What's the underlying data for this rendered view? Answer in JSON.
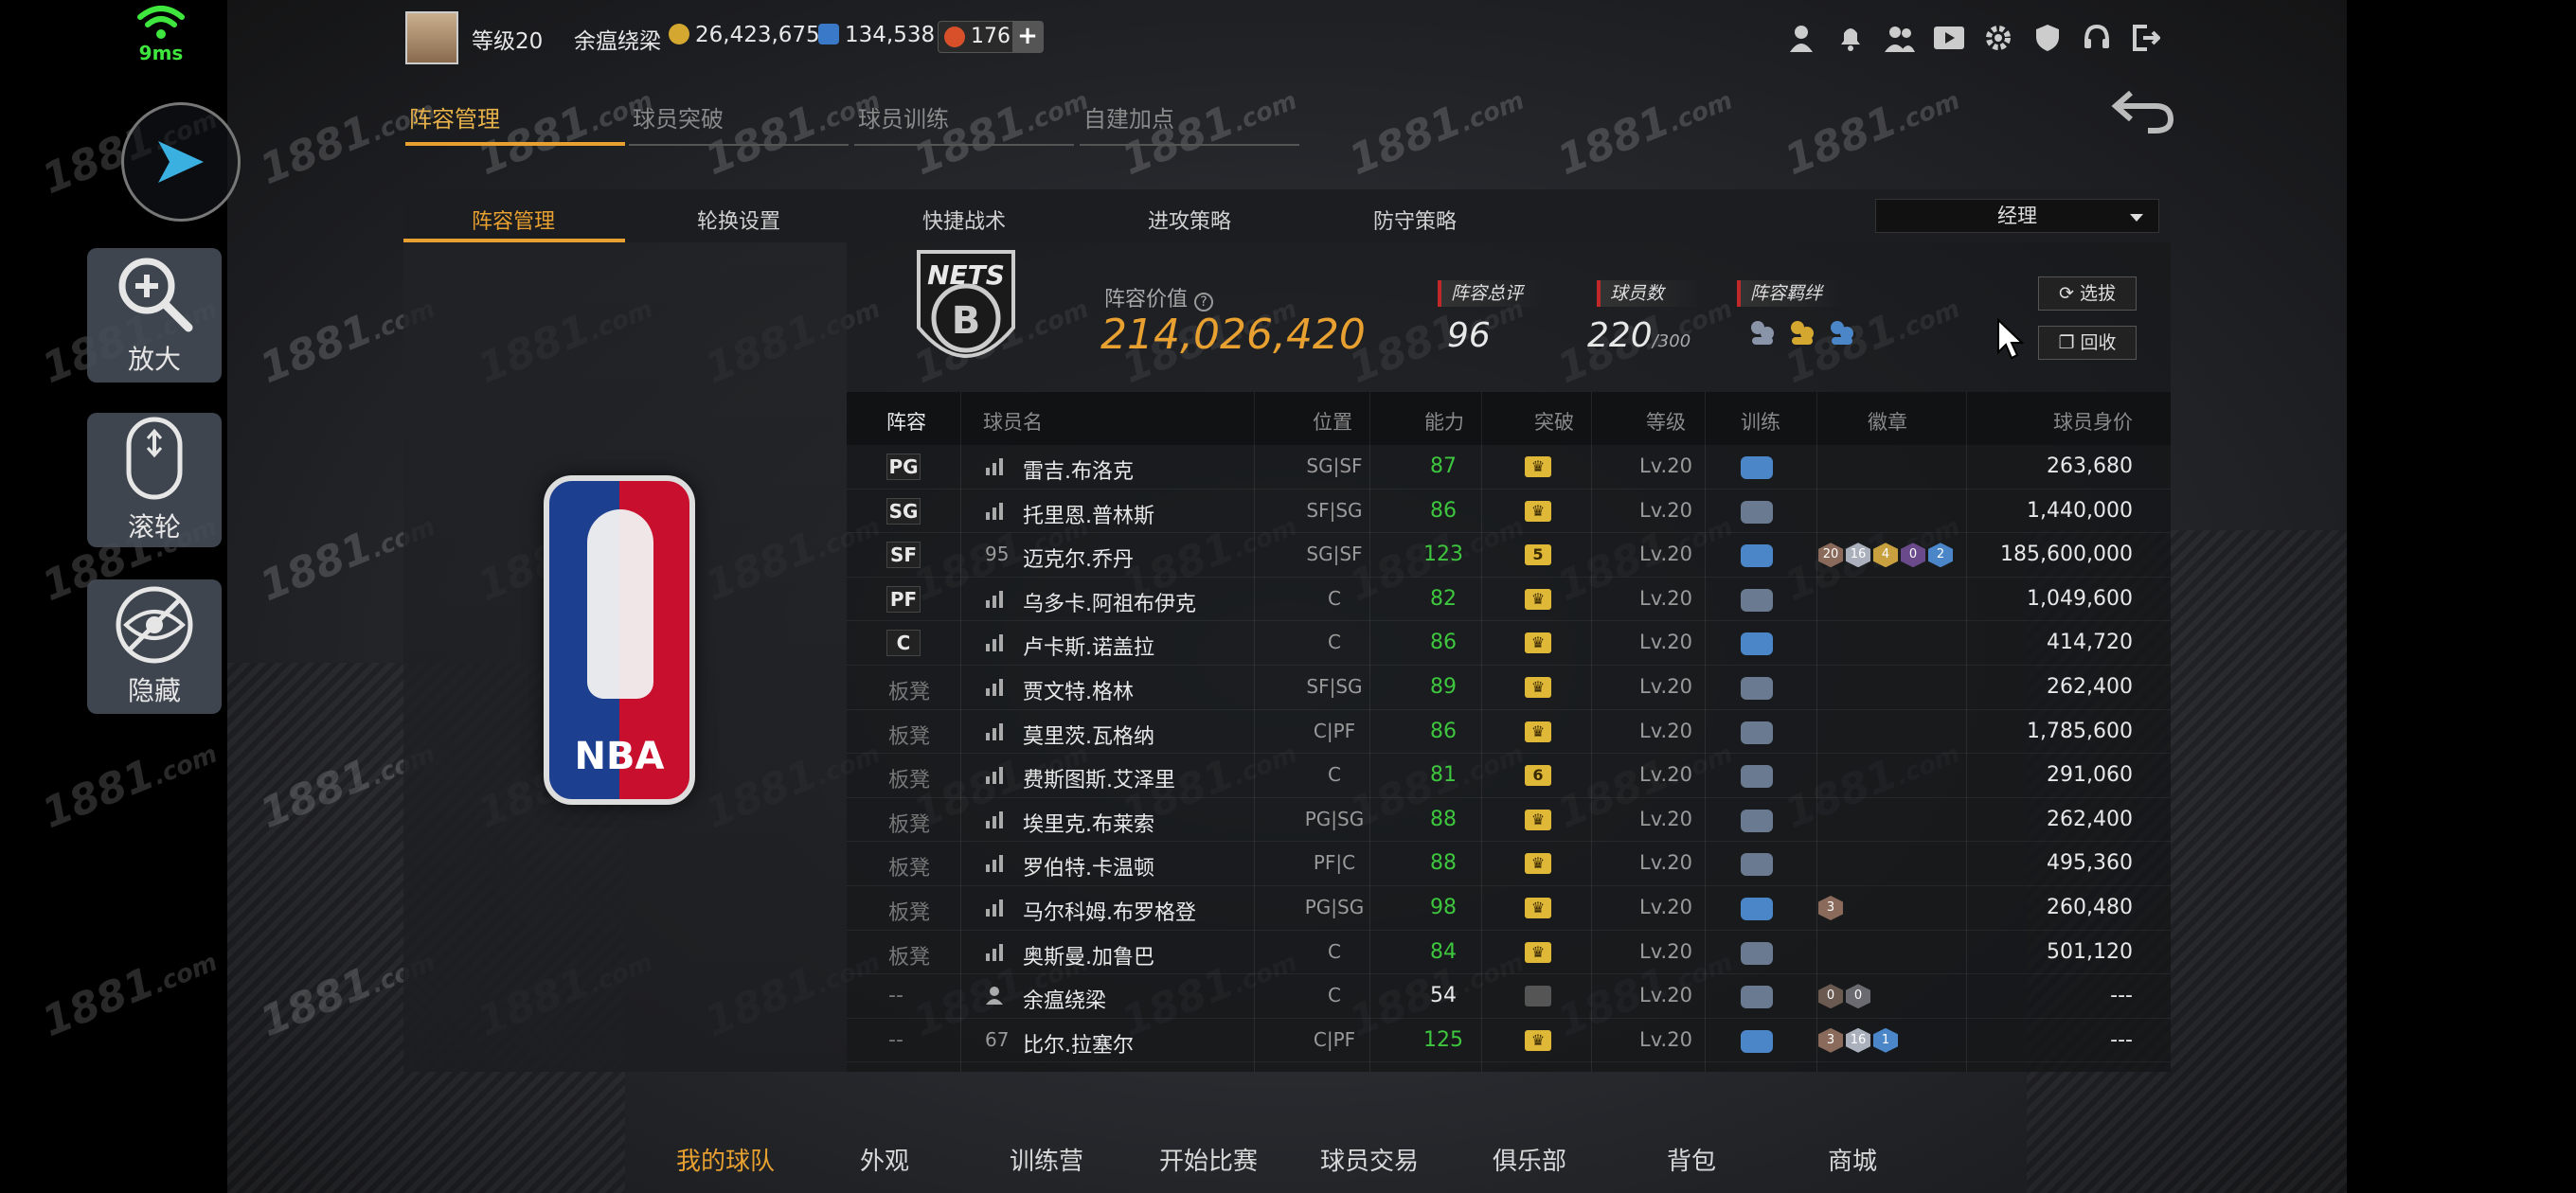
{
  "status": {
    "latency": "9ms"
  },
  "tools": {
    "zoom_label": "放大",
    "wheel_label": "滚轮",
    "hide_label": "隐藏"
  },
  "topbar": {
    "level": "等级20",
    "player_name": "余瘟绕梁",
    "gold": "26,423,675",
    "points": "134,538",
    "coupons": "176",
    "plus": "+"
  },
  "topicons": [
    "user-icon",
    "bell-icon",
    "friends-icon",
    "video-icon",
    "gear-icon",
    "shield-icon",
    "headset-icon",
    "exit-icon"
  ],
  "main_tabs": [
    {
      "label": "阵容管理",
      "active": true
    },
    {
      "label": "球员突破",
      "active": false
    },
    {
      "label": "球员训练",
      "active": false
    },
    {
      "label": "自建加点",
      "active": false
    }
  ],
  "sub_tabs": [
    {
      "label": "阵容管理",
      "active": true
    },
    {
      "label": "轮换设置",
      "active": false
    },
    {
      "label": "快捷战术",
      "active": false
    },
    {
      "label": "进攻策略",
      "active": false
    },
    {
      "label": "防守策略",
      "active": false
    }
  ],
  "dropdown": {
    "value": "经理"
  },
  "team": {
    "logo_text": "NETS",
    "value_label": "阵容价值",
    "value": "214,026,420",
    "rating_label": "阵容总评",
    "rating": "96",
    "count_label": "球员数",
    "count": "220",
    "count_max": "/300",
    "bond_label": "阵容羁绊"
  },
  "side_buttons": {
    "select": "选拔",
    "recycle": "回收"
  },
  "table": {
    "headers": {
      "lineup": "阵容",
      "name": "球员名",
      "position": "位置",
      "ability": "能力",
      "breakthrough": "突破",
      "level": "等级",
      "training": "训练",
      "badges": "徽章",
      "price": "球员身价"
    },
    "rows": [
      {
        "slot": "PG",
        "starter": true,
        "tag": "",
        "name": "雷吉.布洛克",
        "pos": "SG|SF",
        "ability": "87",
        "ability_color": "green",
        "break": "",
        "level": "Lv.20",
        "train": "blue",
        "badges": [],
        "price": "263,680"
      },
      {
        "slot": "SG",
        "starter": true,
        "tag": "",
        "name": "托里恩.普林斯",
        "pos": "SF|SG",
        "ability": "86",
        "ability_color": "green",
        "break": "",
        "level": "Lv.20",
        "train": "gray",
        "badges": [],
        "price": "1,440,000"
      },
      {
        "slot": "SF",
        "starter": true,
        "tag": "95",
        "name": "迈克尔.乔丹",
        "pos": "SG|SF",
        "ability": "123",
        "ability_color": "green",
        "break": "5",
        "level": "Lv.20",
        "train": "blue",
        "badges": [
          {
            "t": "20",
            "c": "#8a6a5a"
          },
          {
            "t": "16",
            "c": "#aab0bc"
          },
          {
            "t": "4",
            "c": "#c8a040"
          },
          {
            "t": "0",
            "c": "#6a4a8a"
          },
          {
            "t": "2",
            "c": "#4a86c8"
          }
        ],
        "price": "185,600,000"
      },
      {
        "slot": "PF",
        "starter": true,
        "tag": "",
        "name": "乌多卡.阿祖布伊克",
        "pos": "C",
        "ability": "82",
        "ability_color": "green",
        "break": "",
        "level": "Lv.20",
        "train": "gray",
        "badges": [],
        "price": "1,049,600"
      },
      {
        "slot": "C",
        "starter": true,
        "tag": "",
        "name": "卢卡斯.诺盖拉",
        "pos": "C",
        "ability": "86",
        "ability_color": "green",
        "break": "",
        "level": "Lv.20",
        "train": "blue",
        "badges": [],
        "price": "414,720"
      },
      {
        "slot": "板凳",
        "starter": false,
        "tag": "",
        "name": "贾文特.格林",
        "pos": "SF|SG",
        "ability": "89",
        "ability_color": "green",
        "break": "",
        "level": "Lv.20",
        "train": "gray",
        "badges": [],
        "price": "262,400"
      },
      {
        "slot": "板凳",
        "starter": false,
        "tag": "",
        "name": "莫里茨.瓦格纳",
        "pos": "C|PF",
        "ability": "86",
        "ability_color": "green",
        "break": "",
        "level": "Lv.20",
        "train": "gray",
        "badges": [],
        "price": "1,785,600"
      },
      {
        "slot": "板凳",
        "starter": false,
        "tag": "",
        "name": "费斯图斯.艾泽里",
        "pos": "C",
        "ability": "81",
        "ability_color": "green",
        "break": "6",
        "level": "Lv.20",
        "train": "gray",
        "badges": [],
        "price": "291,060"
      },
      {
        "slot": "板凳",
        "starter": false,
        "tag": "",
        "name": "埃里克.布莱索",
        "pos": "PG|SG",
        "ability": "88",
        "ability_color": "green",
        "break": "",
        "level": "Lv.20",
        "train": "gray",
        "badges": [],
        "price": "262,400"
      },
      {
        "slot": "板凳",
        "starter": false,
        "tag": "",
        "name": "罗伯特.卡温顿",
        "pos": "PF|C",
        "ability": "88",
        "ability_color": "green",
        "break": "",
        "level": "Lv.20",
        "train": "gray",
        "badges": [],
        "price": "495,360"
      },
      {
        "slot": "板凳",
        "starter": false,
        "tag": "",
        "name": "马尔科姆.布罗格登",
        "pos": "PG|SG",
        "ability": "98",
        "ability_color": "green",
        "break": "",
        "level": "Lv.20",
        "train": "blue",
        "badges": [
          {
            "t": "3",
            "c": "#8a6a5a"
          }
        ],
        "price": "260,480"
      },
      {
        "slot": "板凳",
        "starter": false,
        "tag": "",
        "name": "奥斯曼.加鲁巴",
        "pos": "C",
        "ability": "84",
        "ability_color": "green",
        "break": "",
        "level": "Lv.20",
        "train": "gray",
        "badges": [],
        "price": "501,120"
      },
      {
        "slot": "--",
        "starter": false,
        "tag": "user",
        "name": "余瘟绕梁",
        "pos": "C",
        "ability": "54",
        "ability_color": "white",
        "break": "dim",
        "level": "Lv.20",
        "train": "gray",
        "badges": [
          {
            "t": "0",
            "c": "#6a5a50"
          },
          {
            "t": "0",
            "c": "#6a6a70"
          }
        ],
        "price": "---"
      },
      {
        "slot": "--",
        "starter": false,
        "tag": "67",
        "name": "比尔.拉塞尔",
        "pos": "C|PF",
        "ability": "125",
        "ability_color": "green",
        "break": "",
        "level": "Lv.20",
        "train": "blue",
        "badges": [
          {
            "t": "3",
            "c": "#8a6a5a"
          },
          {
            "t": "16",
            "c": "#aab0bc"
          },
          {
            "t": "1",
            "c": "#4a86c8"
          }
        ],
        "price": "---"
      }
    ]
  },
  "bottom_nav": [
    {
      "label": "我的球队",
      "active": true
    },
    {
      "label": "外观",
      "active": false
    },
    {
      "label": "训练营",
      "active": false
    },
    {
      "label": "开始比赛",
      "active": false
    },
    {
      "label": "球员交易",
      "active": false
    },
    {
      "label": "俱乐部",
      "active": false
    },
    {
      "label": "背包",
      "active": false
    },
    {
      "label": "商城",
      "active": false
    }
  ],
  "watermark": "1881",
  "watermark_suffix": ".com",
  "colors": {
    "accent": "#e8a030",
    "green": "#3ec63e",
    "red": "#c0282a"
  }
}
